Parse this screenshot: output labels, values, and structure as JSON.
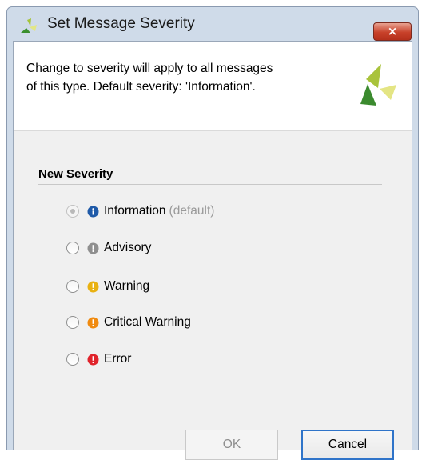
{
  "window": {
    "title": "Set Message Severity",
    "close_glyph": "×"
  },
  "header": {
    "line1": "Change to severity will apply to all messages",
    "line2": "of this type. Default severity: 'Information'."
  },
  "section": {
    "title": "New Severity"
  },
  "options": [
    {
      "label": "Information",
      "suffix": "(default)",
      "icon": "info-icon",
      "color": "#1f5aa8",
      "glyph": "i",
      "selected": true,
      "enabled": false
    },
    {
      "label": "Advisory",
      "icon": "advisory-icon",
      "color": "#8f8f8f",
      "glyph": "!",
      "selected": false,
      "enabled": true
    },
    {
      "label": "Warning",
      "icon": "warning-icon",
      "color": "#e9b111",
      "glyph": "!",
      "selected": false,
      "enabled": true
    },
    {
      "label": "Critical Warning",
      "icon": "critical-warning-icon",
      "color": "#f08a0f",
      "glyph": "!",
      "selected": false,
      "enabled": true
    },
    {
      "label": "Error",
      "icon": "error-icon",
      "color": "#e0232b",
      "glyph": "!",
      "selected": false,
      "enabled": true
    }
  ],
  "buttons": {
    "ok": "OK",
    "cancel": "Cancel"
  }
}
